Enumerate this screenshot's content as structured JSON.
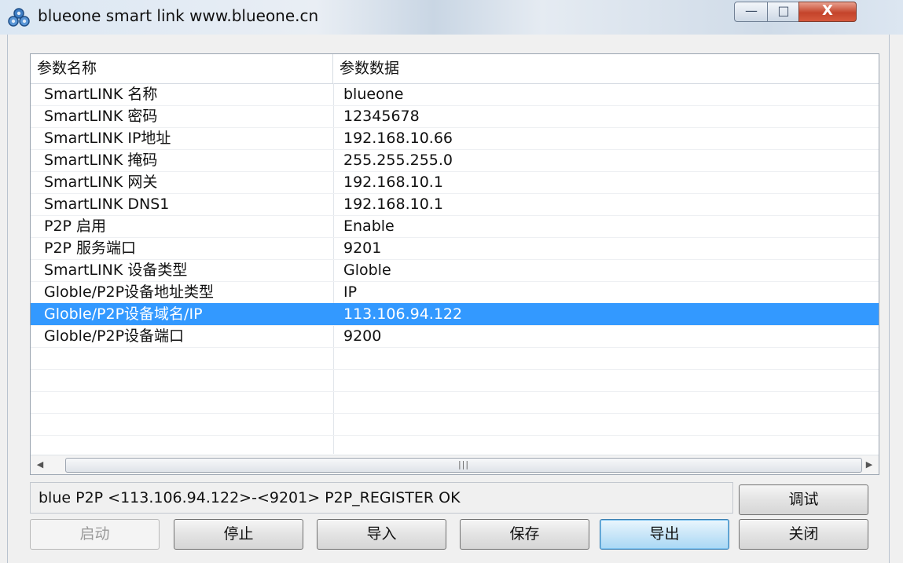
{
  "window": {
    "title": "blueone smart link www.blueone.cn",
    "controls": {
      "minimize": "—",
      "maximize": "□",
      "close": "X"
    }
  },
  "table": {
    "columns": [
      "参数名称",
      "参数数据"
    ],
    "rows": [
      {
        "name": "SmartLINK 名称",
        "value": "blueone"
      },
      {
        "name": "SmartLINK 密码",
        "value": "12345678"
      },
      {
        "name": "SmartLINK IP地址",
        "value": "192.168.10.66"
      },
      {
        "name": "SmartLINK 掩码",
        "value": "255.255.255.0"
      },
      {
        "name": "SmartLINK 网关",
        "value": "192.168.10.1"
      },
      {
        "name": "SmartLINK DNS1",
        "value": "192.168.10.1"
      },
      {
        "name": "P2P 启用",
        "value": "Enable"
      },
      {
        "name": "P2P 服务端口",
        "value": "9201"
      },
      {
        "name": "SmartLINK 设备类型",
        "value": "Globle"
      },
      {
        "name": "Globle/P2P设备地址类型",
        "value": "IP"
      },
      {
        "name": "Globle/P2P设备域名/IP",
        "value": "113.106.94.122",
        "selected": true
      },
      {
        "name": "Globle/P2P设备端口",
        "value": "9200"
      }
    ],
    "selection_color": "#3399ff"
  },
  "status": {
    "text": "blue P2P <113.106.94.122>-<9201> P2P_REGISTER OK"
  },
  "buttons": {
    "debug": "调试",
    "start": "启动",
    "stop": "停止",
    "import": "导入",
    "save": "保存",
    "export": "导出",
    "close": "关闭"
  }
}
